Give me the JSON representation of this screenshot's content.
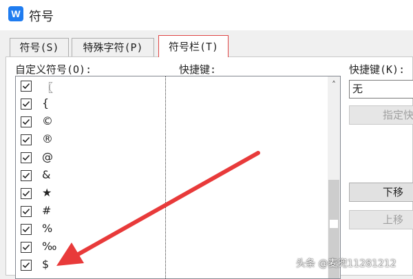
{
  "window": {
    "title": "符号",
    "app_icon_letter": "W"
  },
  "tabs": [
    {
      "label": "符号(S)"
    },
    {
      "label": "特殊字符(P)"
    },
    {
      "label": "符号栏(T)"
    }
  ],
  "labels": {
    "custom_symbols": "自定义符号(O):",
    "shortcut_col": "快捷键:",
    "shortcut_key": "快捷键(K):"
  },
  "symbol_list": [
    {
      "symbol": "〖",
      "checked": true
    },
    {
      "symbol": "{",
      "checked": true
    },
    {
      "symbol": "©",
      "checked": true
    },
    {
      "symbol": "®",
      "checked": true
    },
    {
      "symbol": "@",
      "checked": true
    },
    {
      "symbol": "&",
      "checked": true
    },
    {
      "symbol": "★",
      "checked": true
    },
    {
      "symbol": "#",
      "checked": true
    },
    {
      "symbol": "%",
      "checked": true
    },
    {
      "symbol": "‰",
      "checked": true
    },
    {
      "symbol": "$",
      "checked": true
    }
  ],
  "shortcut_input": {
    "value": "无"
  },
  "buttons": {
    "assign_shortcut": "指定快",
    "move_down": "下移",
    "move_up": "上移"
  },
  "watermark": "头条 @麦兜11281212",
  "colors": {
    "arrow": "#e83a3a",
    "active_tab_border": "#e04545",
    "app_icon": "#1f7cf0"
  }
}
